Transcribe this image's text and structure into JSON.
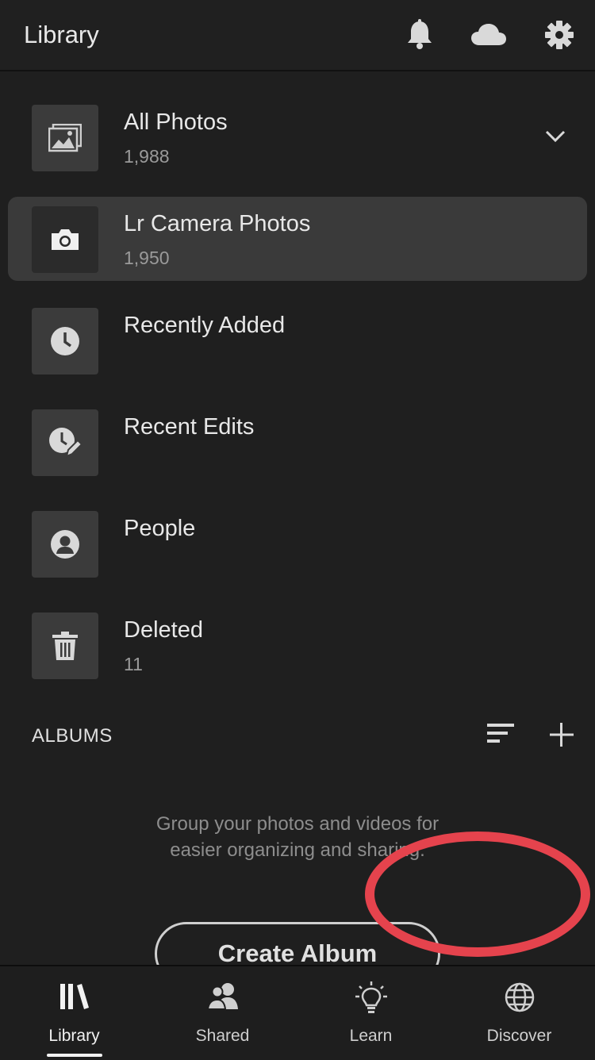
{
  "header": {
    "title": "Library",
    "icons": [
      "bell-icon",
      "cloud-icon",
      "gear-icon"
    ]
  },
  "library_items": [
    {
      "label": "All Photos",
      "count": "1,988",
      "icon": "photos-icon",
      "expandable": true
    },
    {
      "label": "Lr Camera Photos",
      "count": "1,950",
      "icon": "camera-icon",
      "selected": true
    },
    {
      "label": "Recently Added",
      "count": "",
      "icon": "clock-icon"
    },
    {
      "label": "Recent Edits",
      "count": "",
      "icon": "clock-edit-icon"
    },
    {
      "label": "People",
      "count": "",
      "icon": "person-icon"
    },
    {
      "label": "Deleted",
      "count": "11",
      "icon": "trash-icon"
    }
  ],
  "albums": {
    "section_label": "ALBUMS",
    "empty_line1": "Group your photos and videos for",
    "empty_line2": "easier organizing and sharing.",
    "create_label": "Create Album"
  },
  "bottom_nav": [
    {
      "label": "Library",
      "icon": "library-icon",
      "active": true
    },
    {
      "label": "Shared",
      "icon": "shared-people-icon"
    },
    {
      "label": "Learn",
      "icon": "lightbulb-icon"
    },
    {
      "label": "Discover",
      "icon": "globe-icon"
    }
  ],
  "colors": {
    "background": "#1f1f1f",
    "selected_row": "#3a3a3a",
    "annotation_ring": "#e5434d"
  }
}
